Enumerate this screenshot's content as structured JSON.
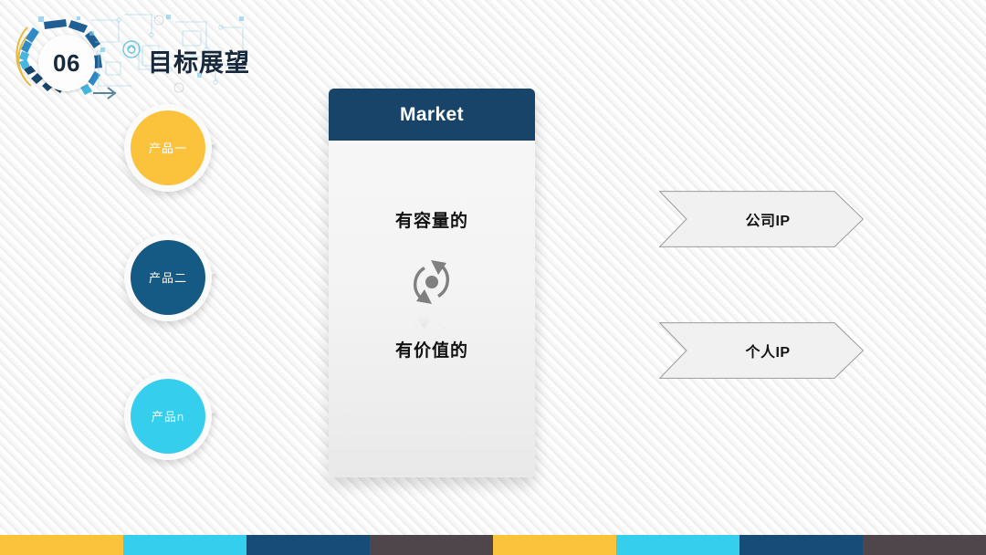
{
  "header": {
    "badge_number": "06",
    "title": "目标展望",
    "badge_icon": "tech-circle-decoration"
  },
  "bubbles": [
    {
      "label": "产品一",
      "color": "#FBC33C",
      "icon": "speech-bubble"
    },
    {
      "label": "产品二",
      "color": "#155985",
      "icon": "speech-bubble"
    },
    {
      "label": "产品n",
      "color": "#35CFED",
      "icon": "speech-bubble"
    }
  ],
  "market_card": {
    "title": "Market",
    "header_color": "#174468",
    "text_top": "有容量的",
    "text_bottom": "有价值的",
    "icon": "refresh-cycle-icon"
  },
  "chevrons": [
    {
      "label": "公司IP",
      "icon": "chevron-banner"
    },
    {
      "label": "个人IP",
      "icon": "chevron-banner"
    }
  ],
  "footer": {
    "segments": [
      {
        "color": "#FBC33C"
      },
      {
        "color": "#35CFED"
      },
      {
        "color": "#174B78"
      },
      {
        "color": "#4F464B"
      },
      {
        "color": "#FBC33C"
      },
      {
        "color": "#35CFED"
      },
      {
        "color": "#174B78"
      },
      {
        "color": "#4F464B"
      }
    ]
  },
  "theme": {
    "background": "#FFFFFF",
    "stripe": "#EFEFEF",
    "accent_yellow": "#FBC33C",
    "accent_cyan": "#35CFED",
    "accent_navy": "#155985",
    "accent_dark": "#4F464B",
    "text_dark": "#17283C"
  }
}
